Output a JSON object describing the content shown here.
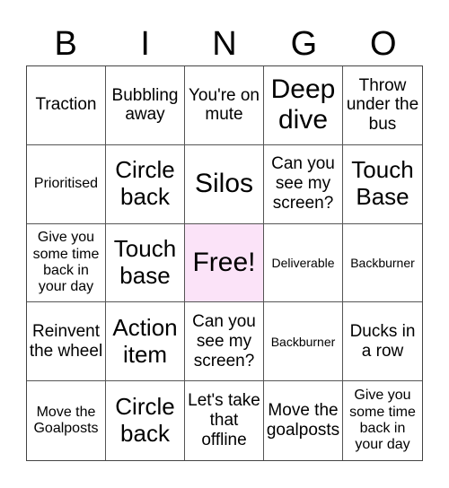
{
  "header": {
    "letters": [
      "B",
      "I",
      "N",
      "G",
      "O"
    ]
  },
  "board": {
    "free_color": "#fbe3f8",
    "cells": [
      {
        "text": "Traction",
        "size": "md"
      },
      {
        "text": "Bubbling away",
        "size": "md"
      },
      {
        "text": "You're on mute",
        "size": "md"
      },
      {
        "text": "Deep dive",
        "size": "xl"
      },
      {
        "text": "Throw under the bus",
        "size": "md"
      },
      {
        "text": "Prioritised",
        "size": "sm"
      },
      {
        "text": "Circle back",
        "size": "lg"
      },
      {
        "text": "Silos",
        "size": "xl"
      },
      {
        "text": "Can you see my screen?",
        "size": "md"
      },
      {
        "text": "Touch Base",
        "size": "lg"
      },
      {
        "text": "Give you some time back in your day",
        "size": "sm"
      },
      {
        "text": "Touch base",
        "size": "lg"
      },
      {
        "text": "Free!",
        "size": "xl",
        "free": true
      },
      {
        "text": "Deliverable",
        "size": "xs"
      },
      {
        "text": "Backburner",
        "size": "xs"
      },
      {
        "text": "Reinvent the wheel",
        "size": "md"
      },
      {
        "text": "Action item",
        "size": "lg"
      },
      {
        "text": "Can you see my screen?",
        "size": "md"
      },
      {
        "text": "Backburner",
        "size": "xs"
      },
      {
        "text": "Ducks in a row",
        "size": "md"
      },
      {
        "text": "Move the Goalposts",
        "size": "sm"
      },
      {
        "text": "Circle back",
        "size": "lg"
      },
      {
        "text": "Let's take that offline",
        "size": "md"
      },
      {
        "text": "Move the goalposts",
        "size": "md"
      },
      {
        "text": "Give you some time back in your day",
        "size": "sm"
      }
    ]
  }
}
